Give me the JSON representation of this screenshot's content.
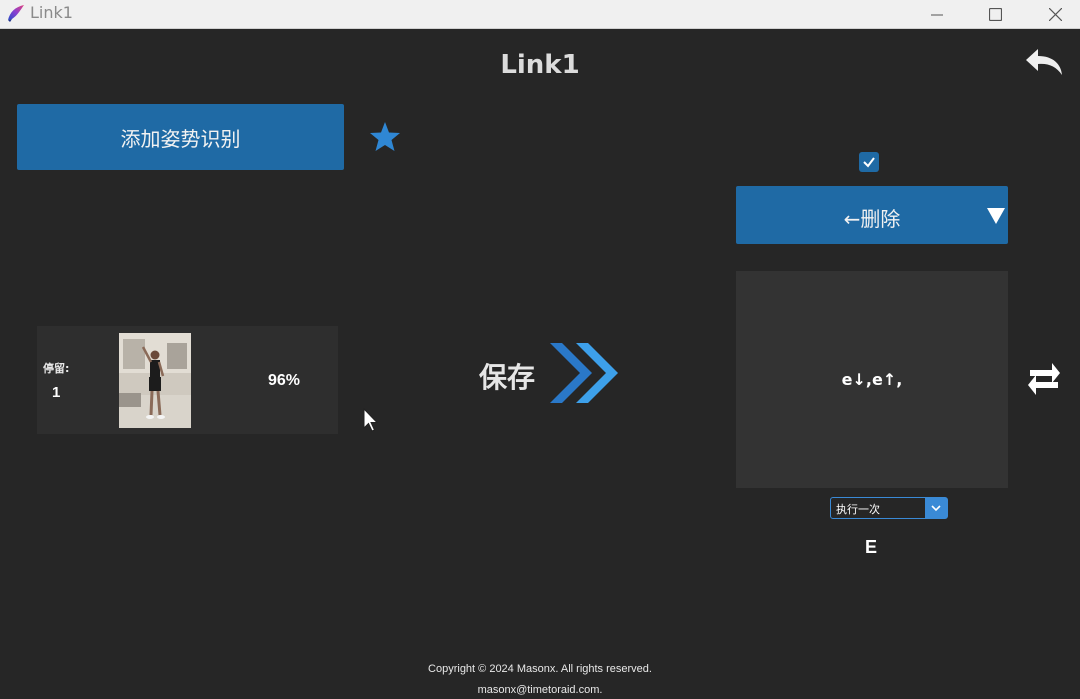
{
  "window": {
    "title": "Link1",
    "controls": [
      "minimize",
      "maximize",
      "close"
    ]
  },
  "header": {
    "title": "Link1",
    "back_icon": "undo-arrow-icon"
  },
  "left": {
    "add_button_label": "添加姿势识别",
    "star_icon": "star-icon",
    "pose_card": {
      "stay_label": "停留:",
      "stay_value": "1",
      "confidence": "96%"
    }
  },
  "center": {
    "save_label": "保存",
    "arrow_icon": "double-chevron-right-icon"
  },
  "right": {
    "checkbox_checked": true,
    "action_label": "←删除",
    "key_sequence": "e↓,e↑,",
    "mode_value": "执行一次",
    "key_letter": "E",
    "swap_icon": "swap-arrows-icon"
  },
  "footer": {
    "copyright": "Copyright © 2024 Masonx. All rights reserved.",
    "email": "masonx@timetoraid.com."
  },
  "colors": {
    "background": "#262626",
    "accent_blue": "#1f6aa5",
    "light_blue": "#3a8ad6",
    "panel": "#333333"
  }
}
